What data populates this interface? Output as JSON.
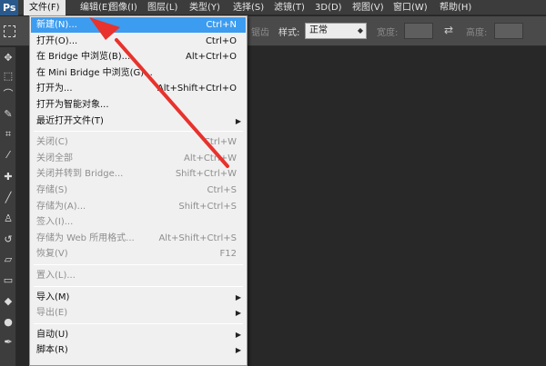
{
  "app": {
    "logo": "Ps"
  },
  "menubar": {
    "items": [
      {
        "label": "文件(F)"
      },
      {
        "label": "编辑(E)"
      },
      {
        "label": "图像(I)"
      },
      {
        "label": "图层(L)"
      },
      {
        "label": "类型(Y)"
      },
      {
        "label": "选择(S)"
      },
      {
        "label": "滤镜(T)"
      },
      {
        "label": "3D(D)"
      },
      {
        "label": "视图(V)"
      },
      {
        "label": "窗口(W)"
      },
      {
        "label": "帮助(H)"
      }
    ]
  },
  "options_bar": {
    "tool_icon": "marquee-icon",
    "clipped_label": "锯齿",
    "style_label": "样式:",
    "style_value": "正常",
    "width_label": "宽度:",
    "height_label": "高度:",
    "swap_icon": "swap-arrows-icon"
  },
  "tools": [
    {
      "icon": "move-icon",
      "glyph": "✥"
    },
    {
      "icon": "marquee-tool-icon",
      "glyph": "⬚"
    },
    {
      "icon": "lasso-icon",
      "glyph": "⌒"
    },
    {
      "icon": "quick-select-icon",
      "glyph": "✎"
    },
    {
      "icon": "crop-icon",
      "glyph": "⌗"
    },
    {
      "icon": "eyedropper-icon",
      "glyph": "⁄"
    },
    {
      "icon": "healing-brush-icon",
      "glyph": "✚"
    },
    {
      "icon": "brush-icon",
      "glyph": "╱"
    },
    {
      "icon": "clone-stamp-icon",
      "glyph": "♙"
    },
    {
      "icon": "history-brush-icon",
      "glyph": "↺"
    },
    {
      "icon": "eraser-icon",
      "glyph": "▱"
    },
    {
      "icon": "gradient-icon",
      "glyph": "▭"
    },
    {
      "icon": "blur-icon",
      "glyph": "◆"
    },
    {
      "icon": "dodge-icon",
      "glyph": "●"
    },
    {
      "icon": "pen-icon",
      "glyph": "✒"
    }
  ],
  "file_menu": {
    "items": [
      {
        "label": "新建(N)...",
        "shortcut": "Ctrl+N",
        "highlighted": true,
        "disabled": false,
        "submenu": false
      },
      {
        "label": "打开(O)...",
        "shortcut": "Ctrl+O",
        "highlighted": false,
        "disabled": false,
        "submenu": false
      },
      {
        "label": "在 Bridge 中浏览(B)...",
        "shortcut": "Alt+Ctrl+O",
        "highlighted": false,
        "disabled": false,
        "submenu": false
      },
      {
        "label": "在 Mini Bridge 中浏览(G)...",
        "shortcut": "",
        "highlighted": false,
        "disabled": false,
        "submenu": false
      },
      {
        "label": "打开为...",
        "shortcut": "Alt+Shift+Ctrl+O",
        "highlighted": false,
        "disabled": false,
        "submenu": false
      },
      {
        "label": "打开为智能对象...",
        "shortcut": "",
        "highlighted": false,
        "disabled": false,
        "submenu": false
      },
      {
        "label": "最近打开文件(T)",
        "shortcut": "",
        "highlighted": false,
        "disabled": false,
        "submenu": true
      },
      {
        "separator": true
      },
      {
        "label": "关闭(C)",
        "shortcut": "Ctrl+W",
        "highlighted": false,
        "disabled": true,
        "submenu": false
      },
      {
        "label": "关闭全部",
        "shortcut": "Alt+Ctrl+W",
        "highlighted": false,
        "disabled": true,
        "submenu": false
      },
      {
        "label": "关闭并转到 Bridge...",
        "shortcut": "Shift+Ctrl+W",
        "highlighted": false,
        "disabled": true,
        "submenu": false
      },
      {
        "label": "存储(S)",
        "shortcut": "Ctrl+S",
        "highlighted": false,
        "disabled": true,
        "submenu": false
      },
      {
        "label": "存储为(A)...",
        "shortcut": "Shift+Ctrl+S",
        "highlighted": false,
        "disabled": true,
        "submenu": false
      },
      {
        "label": "签入(I)...",
        "shortcut": "",
        "highlighted": false,
        "disabled": true,
        "submenu": false
      },
      {
        "label": "存储为 Web 所用格式...",
        "shortcut": "Alt+Shift+Ctrl+S",
        "highlighted": false,
        "disabled": true,
        "submenu": false
      },
      {
        "label": "恢复(V)",
        "shortcut": "F12",
        "highlighted": false,
        "disabled": true,
        "submenu": false
      },
      {
        "separator": true
      },
      {
        "label": "置入(L)...",
        "shortcut": "",
        "highlighted": false,
        "disabled": true,
        "submenu": false
      },
      {
        "separator": true
      },
      {
        "label": "导入(M)",
        "shortcut": "",
        "highlighted": false,
        "disabled": false,
        "submenu": true
      },
      {
        "label": "导出(E)",
        "shortcut": "",
        "highlighted": false,
        "disabled": true,
        "submenu": true
      },
      {
        "separator": true
      },
      {
        "label": "自动(U)",
        "shortcut": "",
        "highlighted": false,
        "disabled": false,
        "submenu": true
      },
      {
        "label": "脚本(R)",
        "shortcut": "",
        "highlighted": false,
        "disabled": false,
        "submenu": true
      }
    ]
  },
  "annotation": {
    "icon": "red-arrow-icon",
    "color": "#e8322d"
  },
  "colors": {
    "menu_highlight": "#3c9cf0",
    "menubar_bg": "#3c3c3c",
    "canvas_bg": "#282828",
    "menu_bg": "#f0f0f0"
  }
}
